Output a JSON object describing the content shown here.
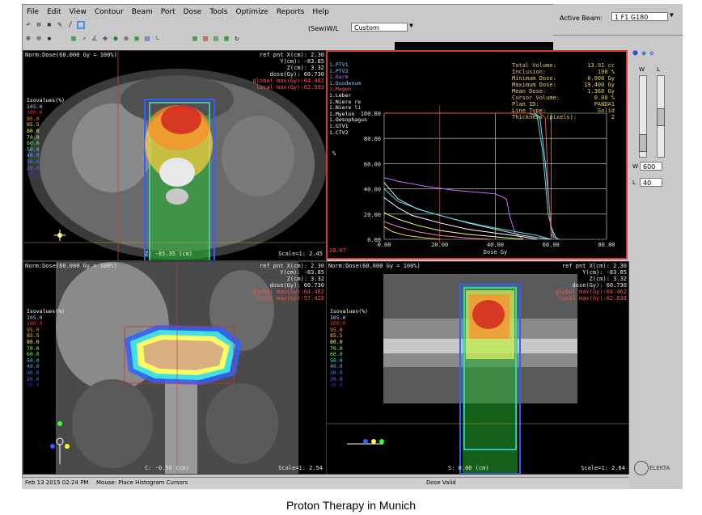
{
  "menu": [
    "File",
    "Edit",
    "View",
    "Contour",
    "Beam",
    "Port",
    "Dose",
    "Tools",
    "Optimize",
    "Reports",
    "Help"
  ],
  "window_level": {
    "label": "(Sew)W/L",
    "value": "Custom"
  },
  "active_beam": {
    "label": "Active Beam:",
    "value": "1 F1 G180"
  },
  "sliders": {
    "w_label": "W",
    "l_label": "L",
    "w_value": "600",
    "l_value": "40"
  },
  "brand": "ELEKTA",
  "views": {
    "axial": {
      "norm": "Norm:Dose(60.000 Gy = 100%)",
      "ref": [
        "ref pnt X(cm):",
        "Y(cm):",
        "Z(cm):",
        "dose(Gy):"
      ],
      "ref_values": [
        "2.30",
        "-83.85",
        "3.32",
        "60.730"
      ],
      "global_max": "global max(Gy):64.462",
      "local_max": "local max(Gy):62.593",
      "pos": "Z:  -85.35 (cm)",
      "scale": "Scale=1: 2.45"
    },
    "coronal": {
      "norm": "Norm:Dose(60.000 Gy = 100%)",
      "ref": [
        "ref pnt X(cm):",
        "Y(cm):",
        "Z(cm):",
        "dose(Gy):"
      ],
      "ref_values": [
        "2.30",
        "-83.85",
        "3.32",
        "60.730"
      ],
      "global_max": "global max(Gy):64.462",
      "local_max": "local max(Gy):57.428",
      "pos": "C:  -0.50 (cm)",
      "scale": "Scale=1: 2.54"
    },
    "sagittal": {
      "norm": "Norm:Dose(60.000 Gy = 100%)",
      "ref": [
        "ref pnt X(cm):",
        "Y(cm):",
        "Z(cm):",
        "dose(Gy):"
      ],
      "ref_values": [
        "2.30",
        "-83.85",
        "3.32",
        "60.730"
      ],
      "global_max": "global max(Gy):64.462",
      "local_max": "local max(Gy):62.638",
      "pos": "S:  0.00 (cm)",
      "scale": "Scale=1: 2.84"
    }
  },
  "isovalues": {
    "title": "Isovalues(%)",
    "items": [
      {
        "label": "105.0",
        "color": "#c8c8ff"
      },
      {
        "label": "100.0",
        "color": "#ff3030"
      },
      {
        "label": "95.0",
        "color": "#ff8c2a"
      },
      {
        "label": "85.5",
        "color": "#ffd040"
      },
      {
        "label": "80.0",
        "color": "#ffff66"
      },
      {
        "label": "70.0",
        "color": "#9cff6a"
      },
      {
        "label": "60.0",
        "color": "#66ff66"
      },
      {
        "label": "50.0",
        "color": "#40e0e0"
      },
      {
        "label": "40.0",
        "color": "#60b0ff"
      },
      {
        "label": "30.0",
        "color": "#2a8cff"
      },
      {
        "label": "20.0",
        "color": "#6a6aff"
      },
      {
        "label": "10.0",
        "color": "#3030c0"
      }
    ]
  },
  "dvh": {
    "structures": [
      {
        "label": "1.PTV1",
        "color": "#7ad0ff"
      },
      {
        "label": "1.PTV2",
        "color": "#7ad0ff"
      },
      {
        "label": "1.Darm",
        "color": "#c070ff"
      },
      {
        "label": "1.Duodenum",
        "color": "#7ad0ff"
      },
      {
        "label": "1.Magen",
        "color": "#ff5050"
      },
      {
        "label": "1.Leber",
        "color": "#ffffff"
      },
      {
        "label": "1.Niere re",
        "color": "#ffffff"
      },
      {
        "label": "1.Niere li",
        "color": "#ffffff"
      },
      {
        "label": "1.Myelon",
        "color": "#ffffff"
      },
      {
        "label": "1.Oesophagus",
        "color": "#ffffff"
      },
      {
        "label": "1.GTV1",
        "color": "#ffffff"
      },
      {
        "label": "1.CTV2",
        "color": "#ffffff"
      }
    ],
    "stats_labels": [
      "Total Volume:",
      "Inclusion:",
      "Minimum Dose:",
      "Maximum Dose:",
      "Mean Dose:",
      "Cursor Volume:",
      "Plan ID:",
      "Line Type:",
      "Thickness (pixels):"
    ],
    "stats_values": [
      "13.91 cc",
      "100 %",
      "0.000 Gy",
      "19.400 Gy",
      "1.360 Gy",
      "0.00 %",
      "PANDA1",
      "Solid",
      "2"
    ],
    "corner": "20.07"
  },
  "chart_data": {
    "type": "line",
    "xlabel": "Dose Gy",
    "ylabel": "%",
    "xlim": [
      0,
      80
    ],
    "ylim": [
      0,
      100
    ],
    "x_ticks": [
      "0.00",
      "20.00",
      "40.00",
      "60.00",
      "80.00"
    ],
    "y_ticks": [
      "0.00",
      "20.00",
      "40.00",
      "60.00",
      "80.00",
      "100.00"
    ],
    "series": [
      {
        "color": "#40e0e0",
        "points": [
          [
            0,
            100
          ],
          [
            52,
            100
          ],
          [
            55,
            98
          ],
          [
            57,
            70
          ],
          [
            59,
            20
          ],
          [
            61,
            2
          ],
          [
            63,
            0
          ]
        ]
      },
      {
        "color": "#8fd8ff",
        "points": [
          [
            0,
            100
          ],
          [
            54,
            100
          ],
          [
            56,
            97
          ],
          [
            58,
            60
          ],
          [
            60,
            10
          ],
          [
            62,
            0
          ]
        ]
      },
      {
        "color": "#ff5050",
        "points": [
          [
            0,
            100
          ],
          [
            56,
            100
          ],
          [
            58,
            96
          ],
          [
            59,
            40
          ],
          [
            60,
            5
          ],
          [
            61,
            0
          ]
        ]
      },
      {
        "color": "#c070ff",
        "points": [
          [
            0,
            49
          ],
          [
            5,
            46
          ],
          [
            15,
            42
          ],
          [
            25,
            39
          ],
          [
            35,
            37
          ],
          [
            40,
            36
          ],
          [
            44,
            32
          ],
          [
            45,
            20
          ],
          [
            47,
            5
          ],
          [
            50,
            0
          ]
        ]
      },
      {
        "color": "#e0e0e0",
        "points": [
          [
            0,
            45
          ],
          [
            5,
            32
          ],
          [
            12,
            24
          ],
          [
            20,
            19
          ],
          [
            30,
            13
          ],
          [
            40,
            8
          ],
          [
            50,
            3
          ],
          [
            56,
            1
          ],
          [
            60,
            0
          ]
        ]
      },
      {
        "color": "#40e0e0",
        "points": [
          [
            0,
            40
          ],
          [
            5,
            30
          ],
          [
            15,
            22
          ],
          [
            25,
            16
          ],
          [
            35,
            11
          ],
          [
            45,
            7
          ],
          [
            55,
            3
          ],
          [
            60,
            0
          ]
        ]
      },
      {
        "color": "#ffffff",
        "points": [
          [
            0,
            33
          ],
          [
            5,
            25
          ],
          [
            10,
            19
          ],
          [
            20,
            13
          ],
          [
            30,
            8
          ],
          [
            40,
            5
          ],
          [
            50,
            2
          ],
          [
            55,
            0
          ]
        ]
      },
      {
        "color": "#ffff66",
        "points": [
          [
            0,
            21
          ],
          [
            5,
            16
          ],
          [
            12,
            11
          ],
          [
            20,
            7
          ],
          [
            30,
            4
          ],
          [
            40,
            2
          ],
          [
            50,
            0
          ]
        ]
      },
      {
        "color": "#ffd040",
        "points": [
          [
            0,
            10
          ],
          [
            3,
            6
          ],
          [
            8,
            3
          ],
          [
            15,
            1
          ],
          [
            20,
            0
          ]
        ]
      },
      {
        "color": "#ff80c0",
        "points": [
          [
            0,
            14
          ],
          [
            5,
            10
          ],
          [
            12,
            6
          ],
          [
            20,
            3
          ],
          [
            30,
            1
          ],
          [
            38,
            0
          ]
        ]
      }
    ]
  },
  "status": {
    "datetime": "Feb 13 2015 02:24 PM",
    "mouse": "Mouse:  Place Histogram Cursors",
    "dose": "Dose Valid"
  },
  "caption": "Proton Therapy in Munich"
}
